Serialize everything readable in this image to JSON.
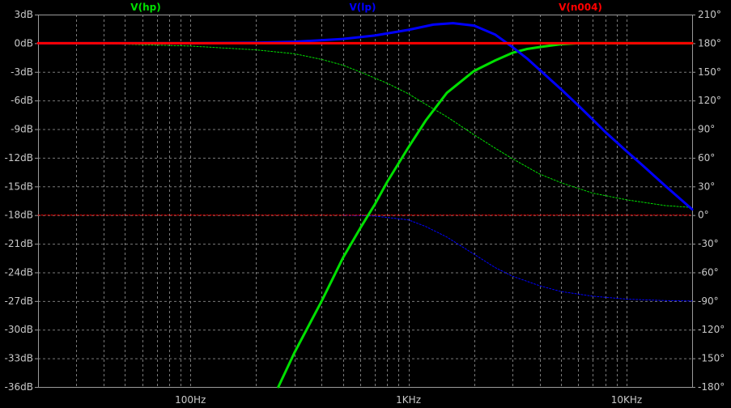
{
  "chart_data": {
    "type": "line",
    "title": "",
    "xlabel": "",
    "ylabel": "",
    "x_scale": "log",
    "xlim": [
      20,
      20000
    ],
    "ylim": [
      -36,
      3
    ],
    "y2lim": [
      -180,
      210
    ],
    "x_major_ticks": [
      {
        "value": 100,
        "label": "100Hz"
      },
      {
        "value": 1000,
        "label": "1KHz"
      },
      {
        "value": 10000,
        "label": "10KHz"
      }
    ],
    "y_ticks": [
      {
        "value": 3,
        "label": "3dB"
      },
      {
        "value": 0,
        "label": "0dB"
      },
      {
        "value": -3,
        "label": "-3dB"
      },
      {
        "value": -6,
        "label": "-6dB"
      },
      {
        "value": -9,
        "label": "-9dB"
      },
      {
        "value": -12,
        "label": "-12dB"
      },
      {
        "value": -15,
        "label": "-15dB"
      },
      {
        "value": -18,
        "label": "-18dB"
      },
      {
        "value": -21,
        "label": "-21dB"
      },
      {
        "value": -24,
        "label": "-24dB"
      },
      {
        "value": -27,
        "label": "-27dB"
      },
      {
        "value": -30,
        "label": "-30dB"
      },
      {
        "value": -33,
        "label": "-33dB"
      },
      {
        "value": -36,
        "label": "-36dB"
      }
    ],
    "y2_ticks": [
      {
        "value": 210,
        "label": "210°"
      },
      {
        "value": 180,
        "label": "180°"
      },
      {
        "value": 150,
        "label": "150°"
      },
      {
        "value": 120,
        "label": "120°"
      },
      {
        "value": 90,
        "label": "90°"
      },
      {
        "value": 60,
        "label": "60°"
      },
      {
        "value": 30,
        "label": "30°"
      },
      {
        "value": 0,
        "label": "0°"
      },
      {
        "value": -30,
        "label": "-30°"
      },
      {
        "value": -60,
        "label": "-60°"
      },
      {
        "value": -90,
        "label": "-90°"
      },
      {
        "value": -120,
        "label": "-120°"
      },
      {
        "value": -150,
        "label": "-150°"
      },
      {
        "value": -180,
        "label": "-180°"
      }
    ],
    "grid": true,
    "legend_placement": "top",
    "series": [
      {
        "name": "V(hp)",
        "color": "#00e000",
        "axis": "magnitude",
        "points": [
          [
            253,
            -36
          ],
          [
            300,
            -32.4
          ],
          [
            400,
            -27
          ],
          [
            500,
            -22.5
          ],
          [
            600,
            -19.4
          ],
          [
            700,
            -16.9
          ],
          [
            800,
            -14.5
          ],
          [
            1000,
            -10.9
          ],
          [
            1200,
            -8.1
          ],
          [
            1500,
            -5.2
          ],
          [
            2000,
            -2.9
          ],
          [
            2500,
            -1.8
          ],
          [
            3000,
            -1.0
          ],
          [
            3500,
            -0.6
          ],
          [
            4000,
            -0.4
          ],
          [
            5000,
            -0.1
          ],
          [
            6000,
            0
          ],
          [
            20000,
            0
          ]
        ]
      },
      {
        "name": "V(hp)",
        "color": "#00e000",
        "axis": "phase",
        "dashed": true,
        "points": [
          [
            20,
            180
          ],
          [
            50,
            179
          ],
          [
            100,
            177
          ],
          [
            200,
            173
          ],
          [
            300,
            169
          ],
          [
            400,
            163
          ],
          [
            500,
            157
          ],
          [
            600,
            150
          ],
          [
            800,
            138
          ],
          [
            1000,
            127
          ],
          [
            1200,
            116
          ],
          [
            1500,
            103
          ],
          [
            2000,
            84
          ],
          [
            2500,
            70
          ],
          [
            3000,
            59
          ],
          [
            4000,
            43
          ],
          [
            5000,
            34
          ],
          [
            7000,
            23
          ],
          [
            10000,
            16
          ],
          [
            15000,
            10
          ],
          [
            20000,
            8
          ]
        ]
      },
      {
        "name": "V(lp)",
        "color": "#0000ff",
        "axis": "magnitude",
        "points": [
          [
            20,
            0
          ],
          [
            100,
            0
          ],
          [
            200,
            0.05
          ],
          [
            300,
            0.15
          ],
          [
            500,
            0.45
          ],
          [
            700,
            0.8
          ],
          [
            1000,
            1.4
          ],
          [
            1300,
            1.95
          ],
          [
            1600,
            2.1
          ],
          [
            2000,
            1.85
          ],
          [
            2500,
            0.9
          ],
          [
            3000,
            -0.4
          ],
          [
            3500,
            -1.6
          ],
          [
            4000,
            -2.8
          ],
          [
            5000,
            -4.8
          ],
          [
            6000,
            -6.5
          ],
          [
            7000,
            -8.0
          ],
          [
            8000,
            -9.3
          ],
          [
            10000,
            -11.3
          ],
          [
            12000,
            -12.9
          ],
          [
            15000,
            -14.9
          ],
          [
            20000,
            -17.4
          ]
        ]
      },
      {
        "name": "V(lp)",
        "color": "#0000ff",
        "axis": "phase",
        "dashed": true,
        "points": [
          [
            500,
            0
          ],
          [
            700,
            -1
          ],
          [
            1000,
            -5
          ],
          [
            1200,
            -12
          ],
          [
            1500,
            -23
          ],
          [
            2000,
            -41
          ],
          [
            2500,
            -55
          ],
          [
            3000,
            -64
          ],
          [
            4000,
            -74
          ],
          [
            5000,
            -80
          ],
          [
            7000,
            -85
          ],
          [
            10000,
            -88
          ],
          [
            15000,
            -89.5
          ],
          [
            20000,
            -90
          ]
        ]
      },
      {
        "name": "V(n004)",
        "color": "#ff0000",
        "axis": "magnitude",
        "points": [
          [
            20,
            0
          ],
          [
            20000,
            0
          ]
        ]
      },
      {
        "name": "V(n004)",
        "color": "#ff0000",
        "axis": "phase",
        "dashed": true,
        "points": [
          [
            20,
            0
          ],
          [
            20000,
            0
          ]
        ]
      }
    ],
    "legend": [
      {
        "label": "V(hp)",
        "color": "#00e000"
      },
      {
        "label": "V(lp)",
        "color": "#0000ff"
      },
      {
        "label": "V(n004)",
        "color": "#ff0000"
      }
    ]
  }
}
